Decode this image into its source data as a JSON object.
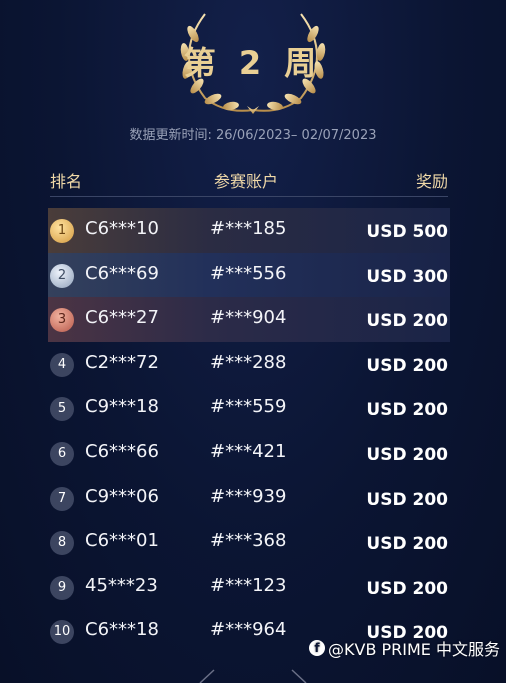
{
  "page": {
    "week_title": "第 2 周",
    "update_line": "数据更新时间: 26/06/2023– 02/07/2023"
  },
  "table": {
    "headers": {
      "rank": "排名",
      "account": "参赛账户",
      "reward": "奖励"
    },
    "rows": [
      {
        "rank": "1",
        "user": "C6***10",
        "account": "#***185",
        "reward": "USD 500",
        "medal": "gold"
      },
      {
        "rank": "2",
        "user": "C6***69",
        "account": "#***556",
        "reward": "USD 300",
        "medal": "silver"
      },
      {
        "rank": "3",
        "user": "C6***27",
        "account": "#***904",
        "reward": "USD 200",
        "medal": "bronze"
      },
      {
        "rank": "4",
        "user": "C2***72",
        "account": "#***288",
        "reward": "USD 200",
        "medal": "plain"
      },
      {
        "rank": "5",
        "user": "C9***18",
        "account": "#***559",
        "reward": "USD 200",
        "medal": "plain"
      },
      {
        "rank": "6",
        "user": "C6***66",
        "account": "#***421",
        "reward": "USD 200",
        "medal": "plain"
      },
      {
        "rank": "7",
        "user": "C9***06",
        "account": "#***939",
        "reward": "USD 200",
        "medal": "plain"
      },
      {
        "rank": "8",
        "user": "C6***01",
        "account": "#***368",
        "reward": "USD 200",
        "medal": "plain"
      },
      {
        "rank": "9",
        "user": "45***23",
        "account": "#***123",
        "reward": "USD 200",
        "medal": "plain"
      },
      {
        "rank": "10",
        "user": "C6***18",
        "account": "#***964",
        "reward": "USD 200",
        "medal": "plain"
      }
    ]
  },
  "watermark": {
    "icon": "facebook-icon",
    "text": "@KVB PRIME 中文服务"
  },
  "colors": {
    "gold": "#e9cf94",
    "background": "#0b1533"
  }
}
